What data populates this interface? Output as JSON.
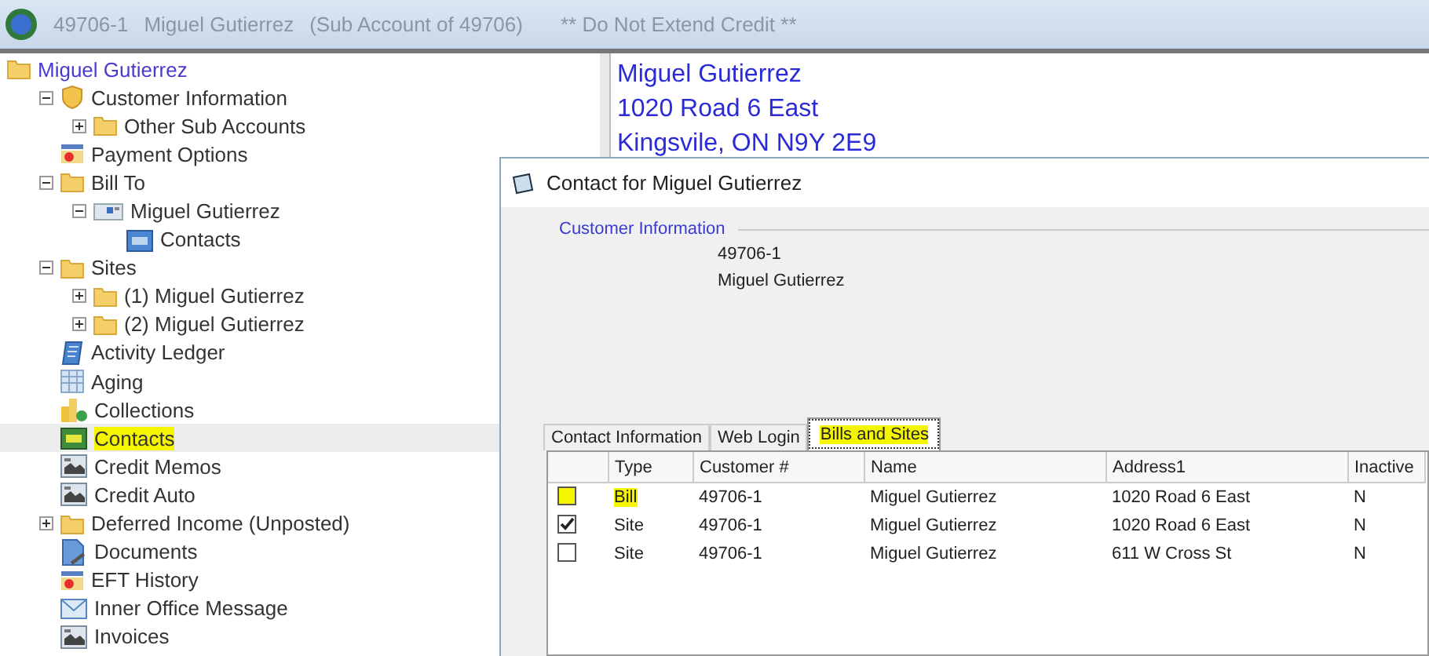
{
  "window": {
    "title_parts": [
      "49706-1",
      "Miguel Gutierrez",
      "(Sub Account of 49706)",
      "** Do Not Extend Credit **"
    ]
  },
  "tree": {
    "root": {
      "label": "Miguel Gutierrez",
      "kind": "folder"
    },
    "items": [
      {
        "label": "Customer Information",
        "kind": "shield",
        "expanded": true,
        "selected": false,
        "children": [
          {
            "label": "Other Sub Accounts",
            "kind": "folder",
            "expanded": false,
            "selected": false
          }
        ]
      },
      {
        "label": "Payment Options",
        "kind": "payment",
        "selected": false
      },
      {
        "label": "Bill To",
        "kind": "folder",
        "expanded": true,
        "selected": false,
        "children": [
          {
            "label": "Miguel Gutierrez",
            "kind": "person",
            "expanded": true,
            "selected": false,
            "children": [
              {
                "label": "Contacts",
                "kind": "contact",
                "selected": false
              }
            ]
          }
        ]
      },
      {
        "label": "Sites",
        "kind": "folder",
        "expanded": true,
        "selected": false,
        "children": [
          {
            "label": "(1) Miguel Gutierrez",
            "kind": "folder",
            "expanded": false,
            "selected": false
          },
          {
            "label": "(2) Miguel Gutierrez",
            "kind": "folder",
            "expanded": false,
            "selected": false
          }
        ]
      },
      {
        "label": "Activity Ledger",
        "kind": "ledger",
        "selected": false
      },
      {
        "label": "Aging",
        "kind": "table",
        "selected": false
      },
      {
        "label": "Collections",
        "kind": "coins",
        "selected": false
      },
      {
        "label": "Contacts",
        "kind": "contact",
        "selected": true
      },
      {
        "label": "Credit Memos",
        "kind": "memo",
        "selected": false
      },
      {
        "label": "Credit Auto",
        "kind": "memo",
        "selected": false
      },
      {
        "label": "Deferred Income (Unposted)",
        "kind": "folder",
        "expanded": false,
        "selected": false
      },
      {
        "label": "Documents",
        "kind": "document",
        "selected": false
      },
      {
        "label": "EFT History",
        "kind": "payment",
        "selected": false
      },
      {
        "label": "Inner Office Message",
        "kind": "mail",
        "selected": false
      },
      {
        "label": "Invoices",
        "kind": "memo",
        "selected": false
      }
    ]
  },
  "address": [
    "Miguel Gutierrez",
    "1020 Road 6 East",
    "Kingsvile, ON  N9Y 2E9"
  ],
  "dialog": {
    "title": "Contact for Miguel Gutierrez",
    "group_label": "Customer Information",
    "customer_lines": [
      "49706-1",
      "Miguel Gutierrez"
    ],
    "tabs": [
      {
        "label": "Contact Information",
        "selected": false
      },
      {
        "label": "Web Login",
        "selected": false
      },
      {
        "label": "Bills and Sites",
        "selected": true
      }
    ],
    "table": {
      "columns": [
        "Type",
        "Customer #",
        "Name",
        "Address1",
        "Inactive"
      ],
      "rows": [
        {
          "checked": false,
          "highlighted": true,
          "cells": [
            "Bill",
            "49706-1",
            "Miguel Gutierrez",
            "1020 Road 6 East",
            "N"
          ]
        },
        {
          "checked": true,
          "highlighted": false,
          "cells": [
            "Site",
            "49706-1",
            "Miguel Gutierrez",
            "1020 Road 6 East",
            "N"
          ]
        },
        {
          "checked": false,
          "highlighted": false,
          "cells": [
            "Site",
            "49706-1",
            "Miguel Gutierrez",
            "611 W Cross St",
            "N"
          ]
        }
      ]
    }
  }
}
